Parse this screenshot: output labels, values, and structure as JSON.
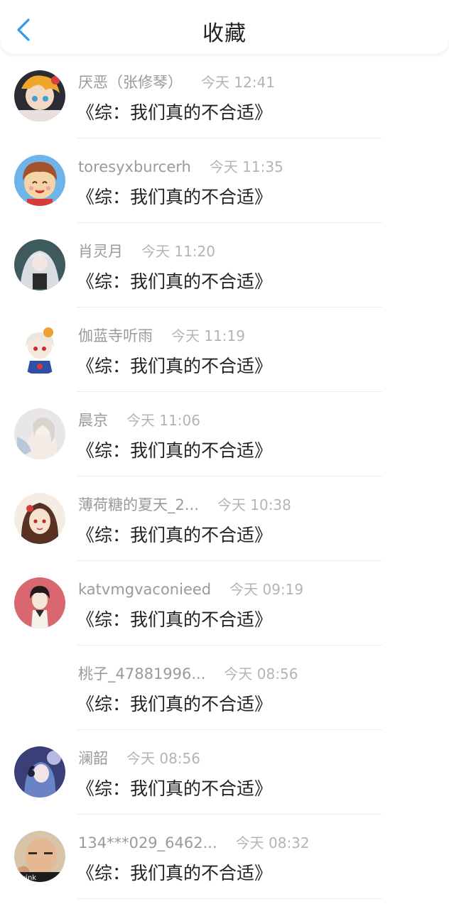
{
  "header": {
    "title": "收藏",
    "back_icon": "chevron-left-icon",
    "accent_color": "#2d9cf0"
  },
  "items": [
    {
      "name": "厌恶（张修琴）",
      "time": "今天 12:41",
      "message": "《综：我们真的不合适》",
      "avatar": "anime-girl-avatar"
    },
    {
      "name": "toresyxburcerh",
      "time": "今天 11:35",
      "message": "《综：我们真的不合适》",
      "avatar": "smiling-cartoon-boy-avatar"
    },
    {
      "name": "肖灵月",
      "time": "今天 11:20",
      "message": "《综：我们真的不合适》",
      "avatar": "gothic-doll-avatar"
    },
    {
      "name": "伽蓝寺听雨",
      "time": "今天 11:19",
      "message": "《综：我们真的不合适》",
      "avatar": "chibi-character-avatar"
    },
    {
      "name": "晨京",
      "time": "今天 11:06",
      "message": "《综：我们真的不合适》",
      "avatar": "anime-illustration-avatar"
    },
    {
      "name": "薄荷糖的夏天_2...",
      "time": "今天 10:38",
      "message": "《综：我们真的不合适》",
      "avatar": "anime-girl-portrait-avatar"
    },
    {
      "name": "katvmgvaconieed",
      "time": "今天 09:19",
      "message": "《综：我们真的不合适》",
      "avatar": "anime-boy-avatar"
    },
    {
      "name": "桃子_47881996...",
      "time": "今天 08:56",
      "message": "《综：我们真的不合适》",
      "avatar": ""
    },
    {
      "name": "澜韶",
      "time": "今天 08:56",
      "message": "《综：我们真的不合适》",
      "avatar": "anime-girl-headphones-avatar"
    },
    {
      "name": "134***029_6462...",
      "time": "今天 08:32",
      "message": "《综：我们真的不合适》",
      "avatar": "man-photo-avatar",
      "avatar_caption": "wink"
    }
  ]
}
